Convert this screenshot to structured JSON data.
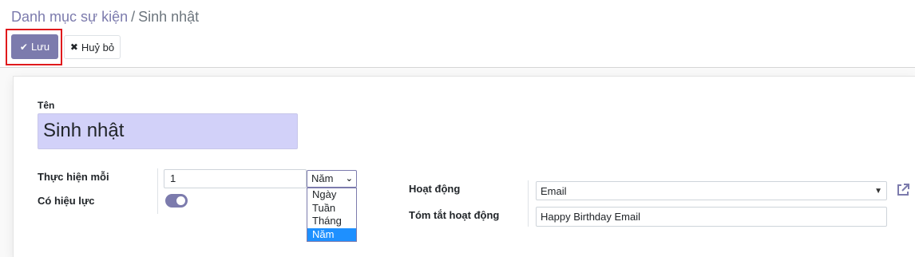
{
  "breadcrumb": {
    "parent": "Danh mục sự kiện",
    "separator": "/",
    "current": "Sinh nhật"
  },
  "toolbar": {
    "save_label": "Lưu",
    "discard_label": "Huỷ bỏ"
  },
  "form": {
    "name_label": "Tên",
    "name_value": "Sinh nhật",
    "interval_label": "Thực hiện mỗi",
    "interval_value": "1",
    "interval_unit": "Năm",
    "interval_unit_options": [
      "Ngày",
      "Tuần",
      "Tháng",
      "Năm"
    ],
    "active_label": "Có hiệu lực",
    "active_value": true,
    "activity_label": "Hoạt động",
    "activity_value": "Email",
    "summary_label": "Tóm tắt hoạt động",
    "summary_value": "Happy Birthday Email"
  },
  "colors": {
    "primary": "#7c7bad",
    "highlight_border": "#e0191c",
    "name_field_bg": "#d2d1f9",
    "selected_option": "#1e90ff"
  }
}
